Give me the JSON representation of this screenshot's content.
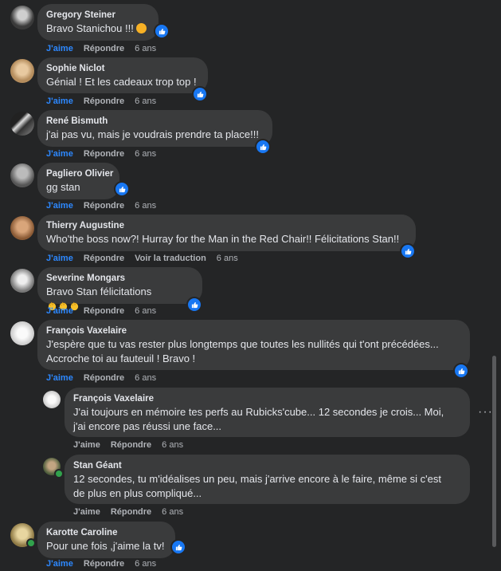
{
  "actions": {
    "like": "J'aime",
    "reply": "Répondre",
    "translate": "Voir la traduction"
  },
  "comments": [
    {
      "author": "Gregory Steiner",
      "text": "Bravo Stanichou !!!",
      "emoji": "smile",
      "time": "6 ans"
    },
    {
      "author": "Sophie Niclot",
      "text": "Génial ! Et les cadeaux trop top !",
      "time": "6 ans"
    },
    {
      "author": "René Bismuth",
      "text": "j'ai pas vu, mais je voudrais prendre ta place!!!",
      "time": "6 ans"
    },
    {
      "author": "Pagliero Olivier",
      "text": "gg stan",
      "time": "6 ans"
    },
    {
      "author": "Thierry Augustine",
      "text": "Who'the boss now?! Hurray for the Man in the Red Chair!! Félicitations Stan!!",
      "time": "6 ans"
    },
    {
      "author": "Severine Mongars",
      "text": "Bravo Stan félicitations",
      "emoji": "clapping-hands",
      "time": "6 ans"
    },
    {
      "author": "François Vaxelaire",
      "text": "J'espère que tu vas rester plus longtemps que toutes les nullités qui t'ont précédées...\nAccroche toi au fauteuil ! Bravo !",
      "time": "6 ans"
    },
    {
      "author": "François Vaxelaire",
      "text": "J'ai toujours en mémoire tes perfs au Rubicks'cube... 12 secondes je crois... Moi,\nj'ai encore pas réussi une face...",
      "time": "6 ans"
    },
    {
      "author": "Stan Géant",
      "text": "12 secondes, tu m'idéalises un peu, mais j'arrive encore à le faire, même si c'est\nde plus en plus compliqué...",
      "time": "6 ans"
    },
    {
      "author": "Karotte Caroline",
      "text": "Pour une fois ,j'aime la tv!",
      "time": "6 ans"
    }
  ],
  "colors": {
    "background": "#242526",
    "bubble": "#3a3b3c",
    "like_blue": "#2d88ff",
    "online_green": "#31a24c"
  },
  "icons": {
    "like_badge": "thumbs-up-icon",
    "more": "more-options-icon"
  }
}
